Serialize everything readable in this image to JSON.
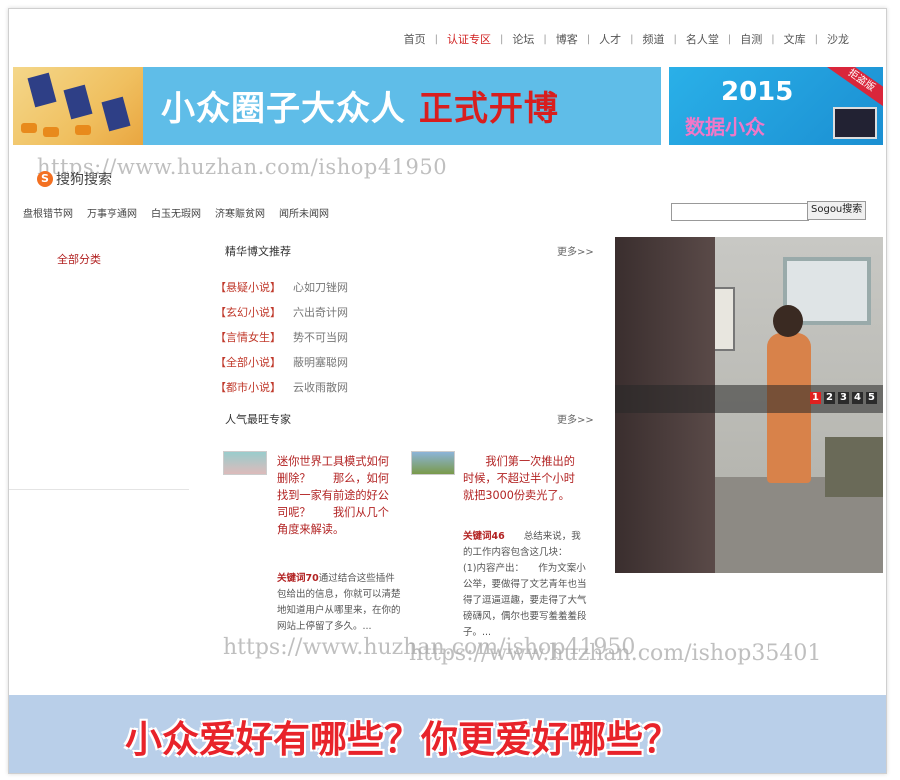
{
  "nav": {
    "items": [
      {
        "label": "首页",
        "active": false
      },
      {
        "label": "认证专区",
        "active": true
      },
      {
        "label": "论坛",
        "active": false
      },
      {
        "label": "博客",
        "active": false
      },
      {
        "label": "人才",
        "active": false
      },
      {
        "label": "频道",
        "active": false
      },
      {
        "label": "名人堂",
        "active": false
      },
      {
        "label": "自测",
        "active": false
      },
      {
        "label": "文库",
        "active": false
      },
      {
        "label": "沙龙",
        "active": false
      }
    ],
    "separator": "|"
  },
  "banner_main": {
    "title_white": "小众圈子大众人",
    "title_red": "正式开博"
  },
  "banner_side": {
    "year": "2015",
    "subtitle": "数据小众",
    "ribbon": "拒盗版"
  },
  "watermarks": {
    "top": "https://www.huzhan.com/ishop41950",
    "mid_left": "https://www.huzhan.com/ishop41950",
    "mid_right": "https://www.huzhan.com/ishop35401"
  },
  "sogou": {
    "logo_text": "搜狗搜索",
    "logo_letter": "S",
    "button": "Sogou搜索",
    "input_value": ""
  },
  "site_links": [
    "盘根错节网",
    "万事亨通网",
    "白玉无瑕网",
    "济寒赈贫网",
    "闻所未闻网"
  ],
  "left": {
    "all_categories": "全部分类"
  },
  "recommend": {
    "title": "精华博文推荐",
    "more": "更多>>",
    "items": [
      {
        "category": "【悬疑小说】",
        "name": "心如刀锉网"
      },
      {
        "category": "【玄幻小说】",
        "name": "六出奇计网"
      },
      {
        "category": "【言情女生】",
        "name": "势不可当网"
      },
      {
        "category": "【全部小说】",
        "name": "蔽明塞聪网"
      },
      {
        "category": "【都市小说】",
        "name": "云收雨散网"
      }
    ]
  },
  "experts": {
    "title": "人气最旺专家",
    "more": "更多>>",
    "items": [
      {
        "headline": "迷你世界工具模式如何删除？　　那么，如何找到一家有前途的好公司呢？　　我们从几个角度来解读。",
        "keyword": "关键词70",
        "summary": "通过结合这些插件包给出的信息，你就可以清楚地知道用户从哪里来，在你的网站上停留了多久。..."
      },
      {
        "headline": "　　我们第一次推出的时候，不超过半个小时就把3000份卖光了。",
        "keyword": "关键词46",
        "summary": "　　总结来说，我的工作内容包含这几块：　　(1)内容产出：　　作为文案小公举，要做得了文艺青年也当得了逗逼逗趣，要走得了大气磅礴风，偶尔也要写羞羞羞段子。..."
      }
    ]
  },
  "slider": {
    "pages": [
      "1",
      "2",
      "3",
      "4",
      "5"
    ],
    "active_page": "1"
  },
  "bottom_banner": {
    "text": "小众爱好有哪些？你更爱好哪些？"
  },
  "colors": {
    "accent_red": "#d81e1e",
    "link_red": "#b22222",
    "banner_blue": "#5fbde8",
    "bottom_banner_bg": "#b9cfe9"
  }
}
